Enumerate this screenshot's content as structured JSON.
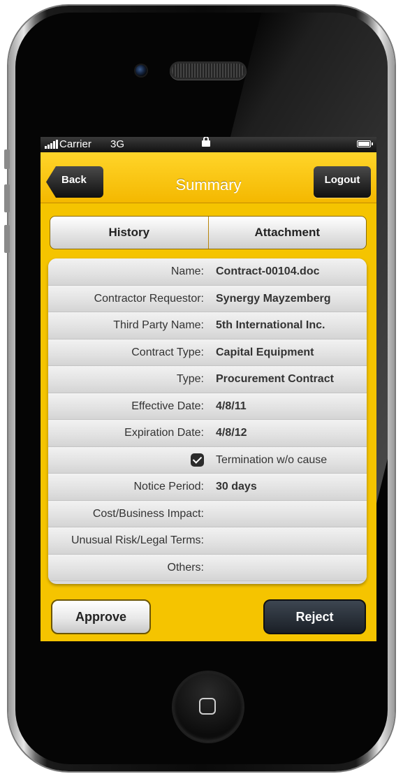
{
  "status_bar": {
    "carrier": "Carrier",
    "network": "3G"
  },
  "navbar": {
    "title": "Summary",
    "back_label": "Back",
    "logout_label": "Logout"
  },
  "tabs": [
    {
      "label": "History"
    },
    {
      "label": "Attachment"
    }
  ],
  "details": {
    "name": {
      "label": "Name:",
      "value": "Contract-00104.doc"
    },
    "contractor_requestor": {
      "label": "Contractor Requestor:",
      "value": "Synergy Mayzemberg"
    },
    "third_party_name": {
      "label": "Third Party Name:",
      "value": "5th International Inc."
    },
    "contract_type": {
      "label": "Contract Type:",
      "value": "Capital Equipment"
    },
    "type": {
      "label": "Type:",
      "value": "Procurement Contract"
    },
    "effective_date": {
      "label": "Effective Date:",
      "value": "4/8/11"
    },
    "expiration_date": {
      "label": "Expiration Date:",
      "value": "4/8/12"
    },
    "termination": {
      "label": "Termination w/o cause",
      "checked": true
    },
    "notice_period": {
      "label": "Notice Period:",
      "value": "30 days"
    },
    "cost_business_impact": {
      "label": "Cost/Business Impact:",
      "value": ""
    },
    "unusual_risk": {
      "label": "Unusual Risk/Legal Terms:",
      "value": ""
    },
    "others": {
      "label": "Others:",
      "value": ""
    }
  },
  "actions": {
    "approve_label": "Approve",
    "reject_label": "Reject"
  },
  "colors": {
    "accent_yellow": "#f5c400",
    "nav_button": "#1a1a1a",
    "reject_button": "#2a313a"
  }
}
